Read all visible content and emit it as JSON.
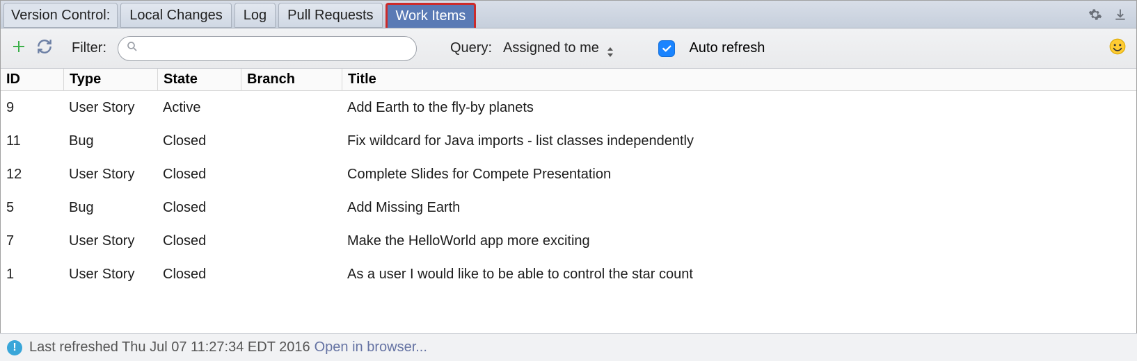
{
  "tabbar": {
    "panel_label": "Version Control:",
    "tabs": [
      {
        "label": "Local Changes",
        "active": false
      },
      {
        "label": "Log",
        "active": false
      },
      {
        "label": "Pull Requests",
        "active": false
      },
      {
        "label": "Work Items",
        "active": true
      }
    ]
  },
  "toolbar": {
    "filter_label": "Filter:",
    "filter_value": "",
    "filter_placeholder": "",
    "query_label": "Query:",
    "query_value": "Assigned to me",
    "auto_refresh_label": "Auto refresh",
    "auto_refresh_checked": true
  },
  "table": {
    "columns": [
      "ID",
      "Type",
      "State",
      "Branch",
      "Title"
    ],
    "rows": [
      {
        "id": "9",
        "type": "User Story",
        "state": "Active",
        "branch": "",
        "title": "Add Earth to the fly-by planets"
      },
      {
        "id": "11",
        "type": "Bug",
        "state": "Closed",
        "branch": "",
        "title": "Fix wildcard for Java imports - list classes independently"
      },
      {
        "id": "12",
        "type": "User Story",
        "state": "Closed",
        "branch": "",
        "title": "Complete Slides for Compete Presentation"
      },
      {
        "id": "5",
        "type": "Bug",
        "state": "Closed",
        "branch": "",
        "title": "Add Missing Earth"
      },
      {
        "id": "7",
        "type": "User Story",
        "state": "Closed",
        "branch": "",
        "title": "Make the HelloWorld app more exciting"
      },
      {
        "id": "1",
        "type": "User Story",
        "state": "Closed",
        "branch": "",
        "title": "As a user I would like to be able to control the star count"
      }
    ]
  },
  "statusbar": {
    "text": "Last refreshed Thu Jul 07 11:27:34 EDT 2016",
    "link": "Open in browser..."
  }
}
